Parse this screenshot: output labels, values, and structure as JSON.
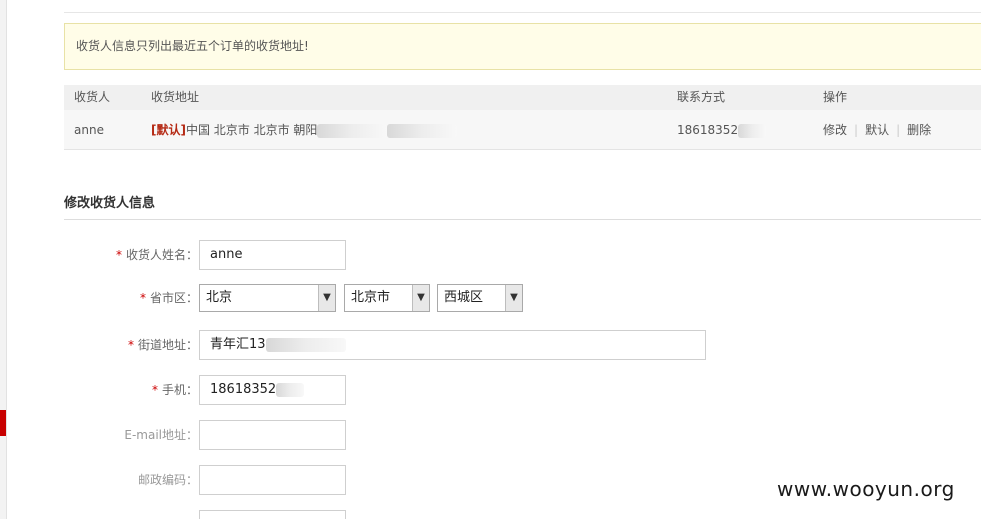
{
  "notice": "收货人信息只列出最近五个订单的收货地址!",
  "table": {
    "headers": [
      "收货人",
      "收货地址",
      "联系方式",
      "操作"
    ],
    "rows": [
      {
        "name": "anne",
        "default_tag": "[默认]",
        "address": "中国 北京市 北京市 朝阳",
        "phone": "18618352",
        "ops": [
          "修改",
          "默认",
          "删除"
        ]
      }
    ]
  },
  "section_title": "修改收货人信息",
  "form": {
    "required_mark": "*",
    "name_label": "收货人姓名：",
    "name_value": "anne",
    "region_label": "省市区：",
    "province": "北京",
    "city": "北京市",
    "district": "西城区",
    "street_label": "街道地址：",
    "street_value": "青年汇13",
    "mobile_label": "手机：",
    "mobile_value": "18618352",
    "email_label": "E-mail地址：",
    "zip_label": "邮政编码："
  },
  "watermark": "www.wooyun.org",
  "colors": {
    "required": "#cc0000",
    "default_tag": "#b52a15",
    "notice_bg": "#fffde8",
    "rail_accent": "#c80000"
  }
}
